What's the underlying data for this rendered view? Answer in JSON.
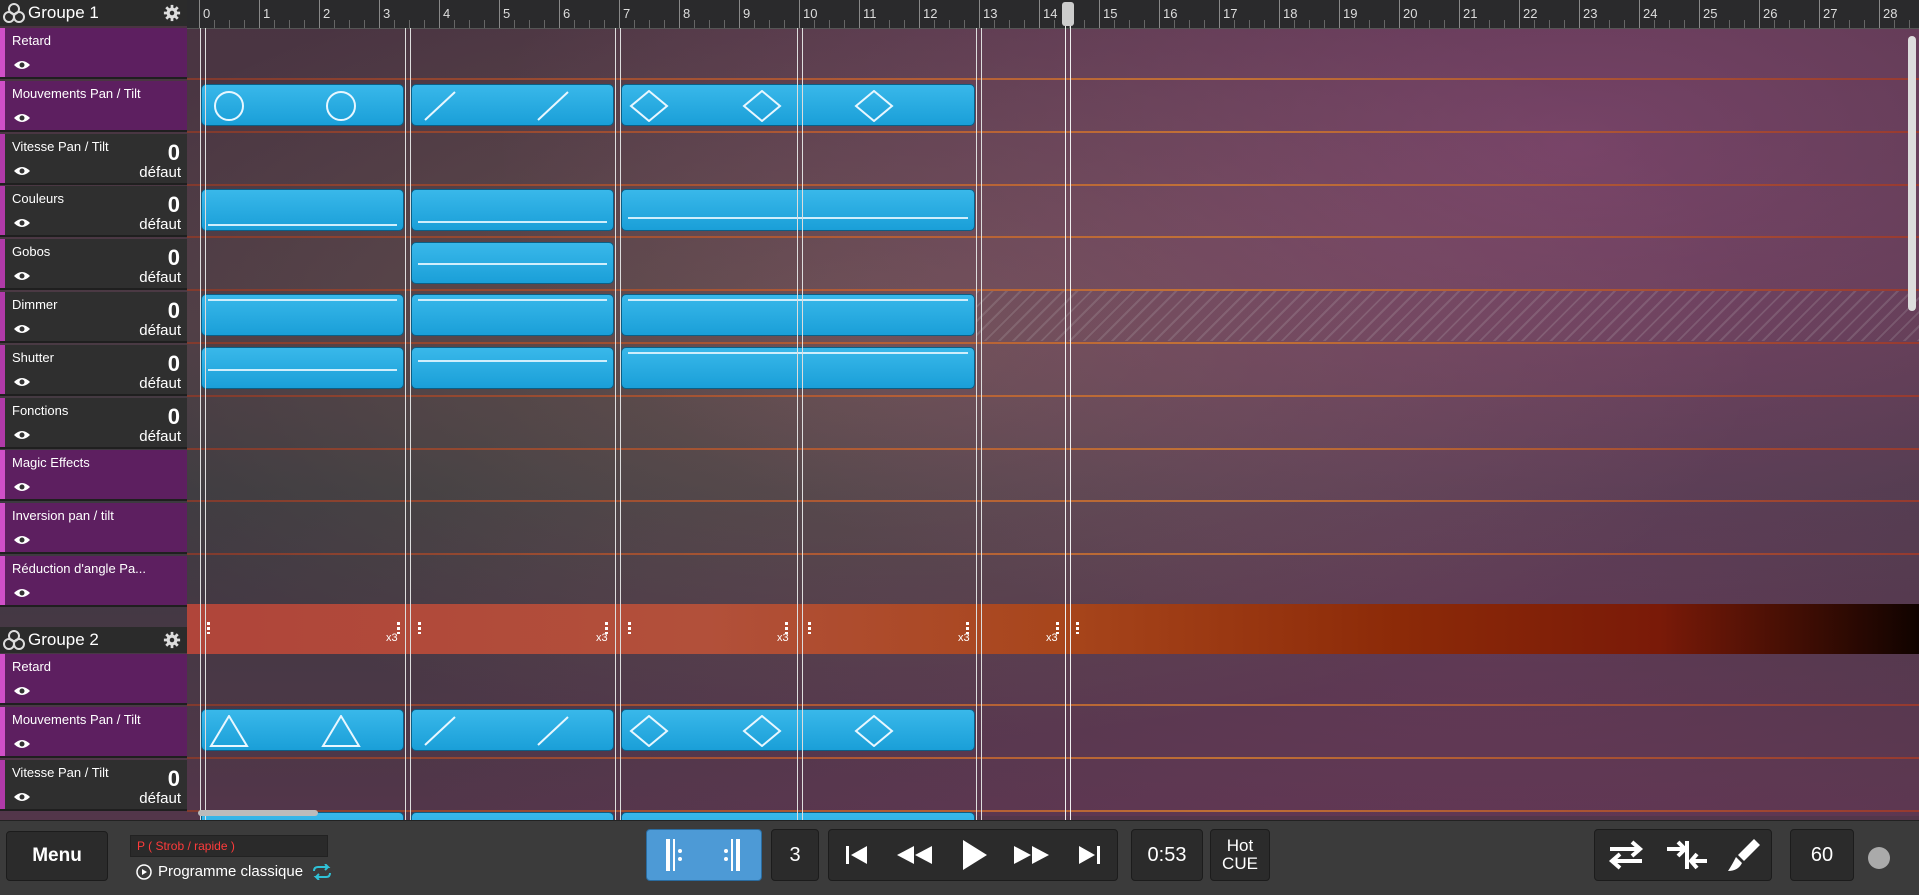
{
  "ruler": {
    "ticks": [
      "0",
      "1",
      "2",
      "3",
      "4",
      "5",
      "6",
      "7",
      "8",
      "9",
      "10",
      "11",
      "12",
      "13",
      "14",
      "15",
      "16",
      "17",
      "18",
      "19",
      "20",
      "21",
      "22",
      "23",
      "24",
      "25",
      "26",
      "27",
      "28"
    ]
  },
  "group1": {
    "name": "Groupe 1",
    "tracks": [
      {
        "name": "Retard",
        "value": "",
        "unit": ""
      },
      {
        "name": "Mouvements Pan / Tilt",
        "value": "",
        "unit": ""
      },
      {
        "name": "Vitesse Pan / Tilt",
        "value": "0",
        "unit": "défaut"
      },
      {
        "name": "Couleurs",
        "value": "0",
        "unit": "défaut"
      },
      {
        "name": "Gobos",
        "value": "0",
        "unit": "défaut"
      },
      {
        "name": "Dimmer",
        "value": "0",
        "unit": "défaut"
      },
      {
        "name": "Shutter",
        "value": "0",
        "unit": "défaut"
      },
      {
        "name": "Fonctions",
        "value": "0",
        "unit": "défaut"
      },
      {
        "name": "Magic Effects",
        "value": "",
        "unit": ""
      },
      {
        "name": "Inversion pan / tilt",
        "value": "",
        "unit": ""
      },
      {
        "name": "Réduction d'angle Pa...",
        "value": "",
        "unit": ""
      }
    ]
  },
  "loop_labels": [
    "x3",
    "x3",
    "x3",
    "x3",
    "x3"
  ],
  "group2": {
    "name": "Groupe 2",
    "tracks": [
      {
        "name": "Retard",
        "value": "",
        "unit": ""
      },
      {
        "name": "Mouvements Pan / Tilt",
        "value": "",
        "unit": ""
      },
      {
        "name": "Vitesse Pan / Tilt",
        "value": "0",
        "unit": "défaut"
      }
    ]
  },
  "toolbar": {
    "menu_label": "Menu",
    "program_field": "P ( Strob / rapide )",
    "program_mode": "Programme classique",
    "loop_count": "3",
    "time": "0:53",
    "hot_cue_line1": "Hot",
    "hot_cue_line2": "CUE",
    "bpm": "60"
  },
  "colors": {
    "block": "#1fa8e0",
    "track_accent": "#d04fc8",
    "loop_band": "#b0453a"
  },
  "icons": [
    "group-icon",
    "gear-icon",
    "eye-icon",
    "circle-shape",
    "slash-shape",
    "diamond-shape",
    "triangle-shape",
    "loop-start-icon",
    "loop-end-icon",
    "skip-start-icon",
    "rewind-icon",
    "play-icon",
    "fast-forward-icon",
    "skip-end-icon",
    "swap-icon",
    "merge-icon",
    "brush-icon",
    "record-dot"
  ]
}
